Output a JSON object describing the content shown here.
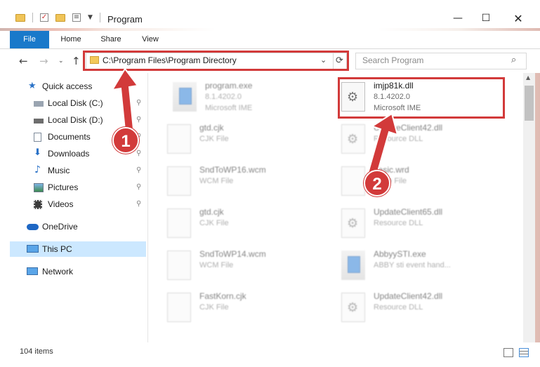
{
  "window": {
    "title": "Program",
    "controls": {
      "minimize": "—",
      "maximize": "☐",
      "close": "✕"
    }
  },
  "ribbon": {
    "tabs": [
      "File",
      "Home",
      "Share",
      "View"
    ]
  },
  "address_bar": {
    "path": "C:\\Program Files\\Program Directory",
    "dropdown_glyph": "⌄",
    "refresh_glyph": "⟳"
  },
  "search": {
    "placeholder": "Search Program",
    "icon": "search-icon"
  },
  "nav_glyphs": {
    "back": "←",
    "forward": "→",
    "recent": "⌄",
    "up": "↑"
  },
  "sidebar": {
    "items": [
      {
        "label": "Quick access",
        "icon": "star-icon"
      },
      {
        "label": "Local Disk (C:)",
        "icon": "drive-icon",
        "pinned": true
      },
      {
        "label": "Local Disk (D:)",
        "icon": "drive-icon",
        "pinned": true
      },
      {
        "label": "Documents",
        "icon": "documents-icon",
        "pinned": true
      },
      {
        "label": "Downloads",
        "icon": "downloads-icon",
        "pinned": true
      },
      {
        "label": "Music",
        "icon": "music-icon",
        "pinned": true
      },
      {
        "label": "Pictures",
        "icon": "pictures-icon",
        "pinned": true
      },
      {
        "label": "Videos",
        "icon": "videos-icon",
        "pinned": true
      },
      {
        "label": "OneDrive",
        "icon": "cloud-icon"
      },
      {
        "label": "This PC",
        "icon": "computer-icon",
        "selected": true
      },
      {
        "label": "Network",
        "icon": "network-icon"
      }
    ],
    "pin_glyph": "📌"
  },
  "files": [
    {
      "name": "program.exe",
      "line2": "8.1.4202.0",
      "line3": "Microsoft IME",
      "icon": "exe-icon"
    },
    {
      "name": "imjp81k.dll",
      "line2": "8.1.4202.0",
      "line3": "Microsoft IME",
      "icon": "dll-gear-icon",
      "highlighted": true
    },
    {
      "name": "gtd.cjk",
      "line2": "CJK File",
      "icon": "file-icon"
    },
    {
      "name": "UpdateClient42.dll",
      "line2": "Resource DLL",
      "icon": "dll-gear-icon"
    },
    {
      "name": "SndToWP16.wcm",
      "line2": "WCM File",
      "icon": "file-icon"
    },
    {
      "name": "basic.wrd",
      "line2": "WRD File",
      "icon": "file-icon"
    },
    {
      "name": "gtd.cjk",
      "line2": "CJK File",
      "icon": "file-icon"
    },
    {
      "name": "UpdateClient65.dll",
      "line2": "Resource DLL",
      "icon": "dll-gear-icon"
    },
    {
      "name": "SndToWP14.wcm",
      "line2": "WCM File",
      "icon": "file-icon"
    },
    {
      "name": "AbbyySTI.exe",
      "line2": "ABBY sti event hand...",
      "icon": "exe-icon"
    },
    {
      "name": "FastKorn.cjk",
      "line2": "CJK File",
      "icon": "file-icon"
    },
    {
      "name": "UpdateClient42.dll",
      "line2": "Resource DLL",
      "icon": "dll-gear-icon"
    }
  ],
  "status": {
    "item_count": "104 items"
  },
  "annotations": [
    {
      "label": "1",
      "color": "#d23a3a"
    },
    {
      "label": "2",
      "color": "#d23a3a"
    }
  ]
}
